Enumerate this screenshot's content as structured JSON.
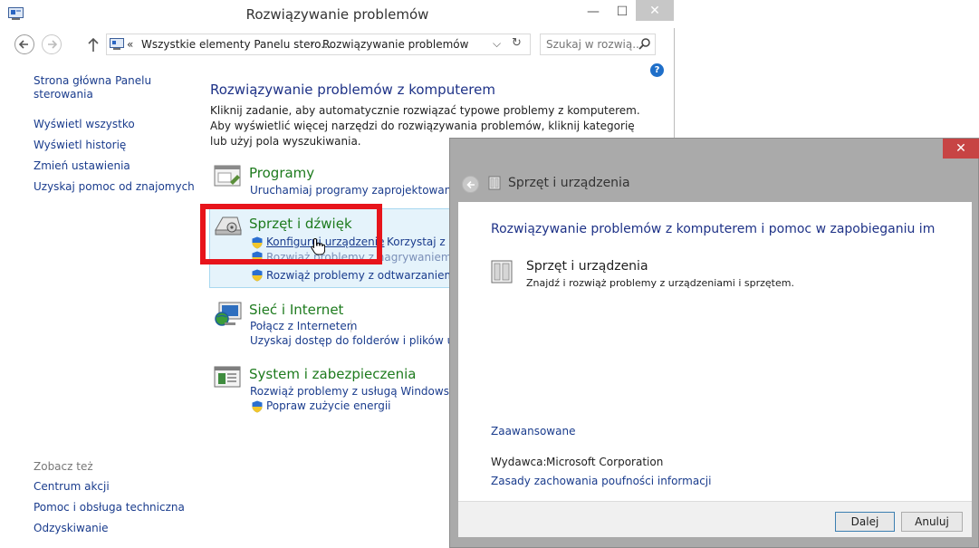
{
  "main_window": {
    "title": "Rozwiązywanie problemów",
    "address": {
      "chevron": "«",
      "crumb1": "Wszystkie elementy Panelu stero...",
      "separator": "›",
      "crumb2": "Rozwiązywanie problemów"
    },
    "search": {
      "placeholder": "Szukaj w rozwią..."
    }
  },
  "sidebar": {
    "home": "Strona główna Panelu sterowania",
    "show_all": "Wyświetl wszystko",
    "history": "Wyświetl historię",
    "change_settings": "Zmień ustawienia",
    "get_help": "Uzyskaj pomoc od znajomych",
    "see_also": "Zobacz też",
    "action_center": "Centrum akcji",
    "support": "Pomoc i obsługa techniczna",
    "recovery": "Odzyskiwanie"
  },
  "content": {
    "heading": "Rozwiązywanie problemów z komputerem",
    "description": "Kliknij zadanie, aby automatycznie rozwiązać typowe problemy z komputerem. Aby wyświetlić więcej narzędzi do rozwiązywania problemów, kliknij kategorię lub użyj pola wyszukiwania.",
    "categories": [
      {
        "title": "Programy",
        "links": [
          "Uruchamiaj programy zaprojektowane na"
        ]
      },
      {
        "title": "Sprzęt i dźwięk",
        "links": [
          "Konfiguruj urządzenie",
          "Korzystaj z dr",
          "Rozwiąż problemy z odtwarzaniem dźw",
          "Rozwiąż problemy z nagrywaniem dźw"
        ]
      },
      {
        "title": "Sieć i Internet",
        "links": [
          "Połącz z Internetem",
          "Uzyskaj dostęp do folderów i plików udost"
        ]
      },
      {
        "title": "System i zabezpieczenia",
        "links": [
          "Rozwiąż problemy z usługą Windows Upd",
          "Popraw zużycie energii"
        ]
      }
    ]
  },
  "dialog": {
    "title": "Sprzęt i urządzenia",
    "heading": "Rozwiązywanie problemów z komputerem i pomoc w zapobieganiu im",
    "item_title": "Sprzęt i urządzenia",
    "item_desc": "Znajdź i rozwiąż problemy z urządzeniami i sprzętem.",
    "advanced": "Zaawansowane",
    "publisher_label": "Wydawca:",
    "publisher_value": "Microsoft Corporation",
    "privacy": "Zasady zachowania poufności informacji",
    "next_button": "Dalej",
    "cancel_button": "Anuluj"
  },
  "colors": {
    "link": "#1a3c8d",
    "heading": "#1e3287",
    "category": "#1e7b1e",
    "highlight_frame": "#e7141b",
    "dialog_close": "#c74444"
  }
}
